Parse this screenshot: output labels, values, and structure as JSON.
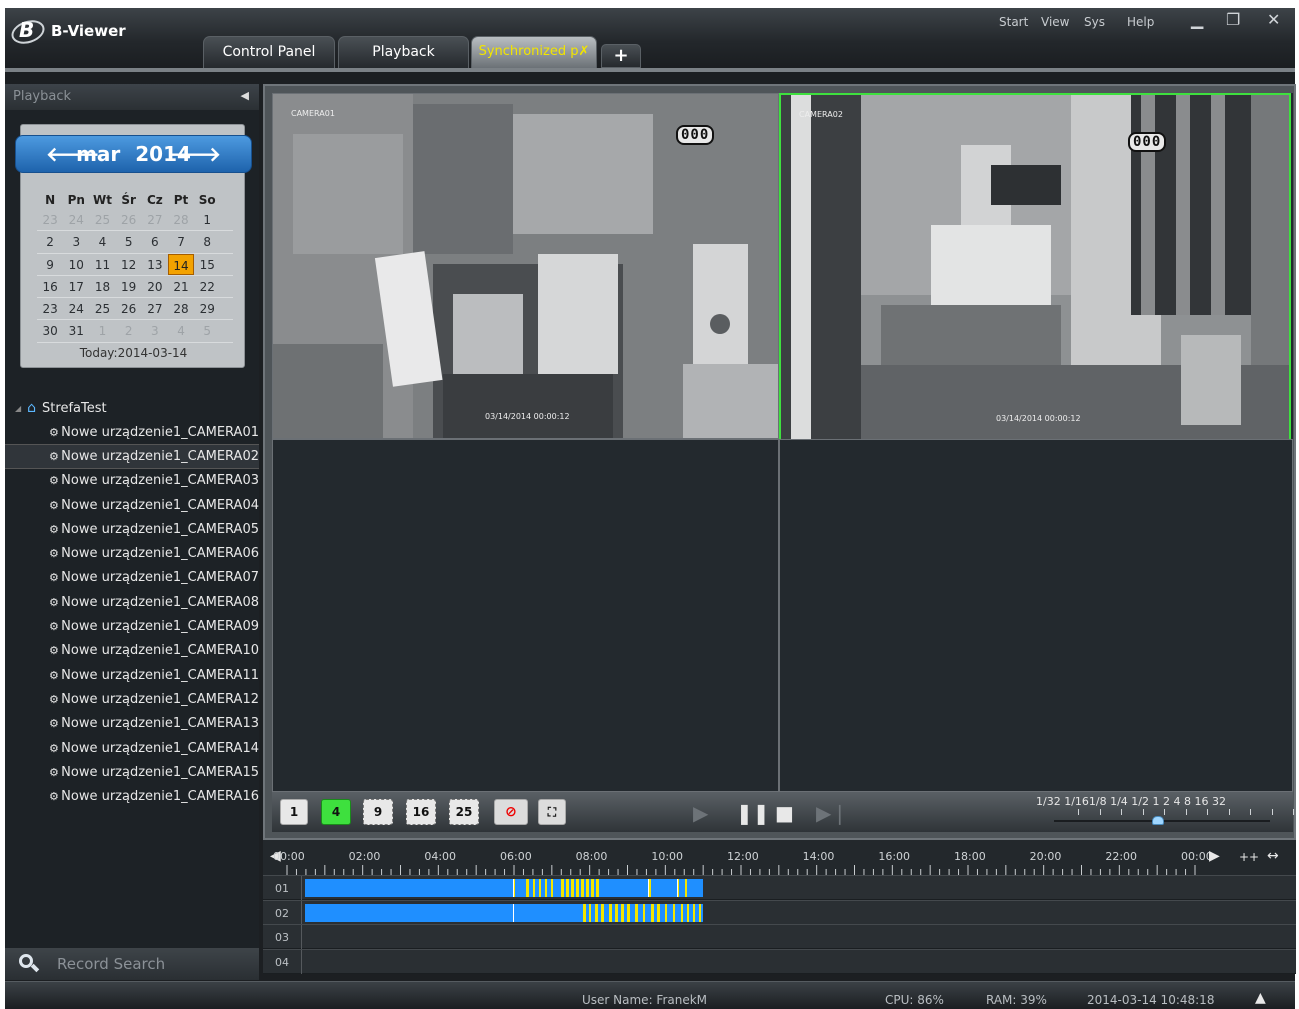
{
  "app": {
    "title": "B-Viewer",
    "logo_letter": "B"
  },
  "menu": [
    "Start",
    "View",
    "Sys",
    "Help"
  ],
  "window_controls": {
    "minimize": "▁",
    "restore": "❐",
    "close": "✕"
  },
  "tabs": [
    {
      "label": "Control Panel",
      "active": false
    },
    {
      "label": "Playback",
      "active": false
    },
    {
      "label": "Synchronized p",
      "active": true
    }
  ],
  "tab_add_label": "+",
  "left_panel": {
    "header": "Playback",
    "calendar": {
      "month": "mar",
      "year": "2014",
      "weekdays": [
        "N",
        "Pn",
        "Wt",
        "Śr",
        "Cz",
        "Pt",
        "So"
      ],
      "weeks": [
        [
          "23",
          "24",
          "25",
          "26",
          "27",
          "28",
          "1"
        ],
        [
          "2",
          "3",
          "4",
          "5",
          "6",
          "7",
          "8"
        ],
        [
          "9",
          "10",
          "11",
          "12",
          "13",
          "14",
          "15"
        ],
        [
          "16",
          "17",
          "18",
          "19",
          "20",
          "21",
          "22"
        ],
        [
          "23",
          "24",
          "25",
          "26",
          "27",
          "28",
          "29"
        ],
        [
          "30",
          "31",
          "1",
          "2",
          "3",
          "4",
          "5"
        ]
      ],
      "selected_day": "14",
      "today_label": "Today:2014-03-14"
    },
    "tree": {
      "root": "StrefaTest",
      "items": [
        "Nowe urządzenie1_CAMERA01",
        "Nowe urządzenie1_CAMERA02",
        "Nowe urządzenie1_CAMERA03",
        "Nowe urządzenie1_CAMERA04",
        "Nowe urządzenie1_CAMERA05",
        "Nowe urządzenie1_CAMERA06",
        "Nowe urządzenie1_CAMERA07",
        "Nowe urządzenie1_CAMERA08",
        "Nowe urządzenie1_CAMERA09",
        "Nowe urządzenie1_CAMERA10",
        "Nowe urządzenie1_CAMERA11",
        "Nowe urządzenie1_CAMERA12",
        "Nowe urządzenie1_CAMERA13",
        "Nowe urządzenie1_CAMERA14",
        "Nowe urządzenie1_CAMERA15",
        "Nowe urządzenie1_CAMERA16"
      ],
      "selected_index": 1
    },
    "record_search": "Record Search"
  },
  "video": {
    "tiles": [
      {
        "label": "CAMERA01",
        "counter": "000",
        "timestamp": "03/14/2014 00:00:12",
        "active": false
      },
      {
        "label": "CAMERA02",
        "counter": "000",
        "timestamp": "03/14/2014 00:00:12",
        "active": true
      }
    ],
    "layout_buttons": [
      "1",
      "4",
      "9",
      "16",
      "25"
    ],
    "active_layout": "4",
    "speed_labels": "1/32 1/161/8 1/4 1/2  1   2   4   8  16  32",
    "speed_level": "1"
  },
  "timeline": {
    "hours": [
      "00:00",
      "02:00",
      "04:00",
      "06:00",
      "08:00",
      "10:00",
      "12:00",
      "14:00",
      "16:00",
      "18:00",
      "20:00",
      "22:00",
      "00:00"
    ],
    "zoom_labels": [
      "++",
      "↔"
    ],
    "tracks": [
      "01",
      "02",
      "03",
      "04"
    ]
  },
  "status_bar": {
    "user": "User Name: FranekM",
    "cpu": "CPU: 86%",
    "ram": "RAM: 39%",
    "datetime": "2014-03-14 10:48:18"
  },
  "colors": {
    "accent_green": "#3ee03e",
    "record_blue": "#1f8fff",
    "motion_yellow": "#f2e500",
    "calendar_head": "#2f7fd0"
  }
}
